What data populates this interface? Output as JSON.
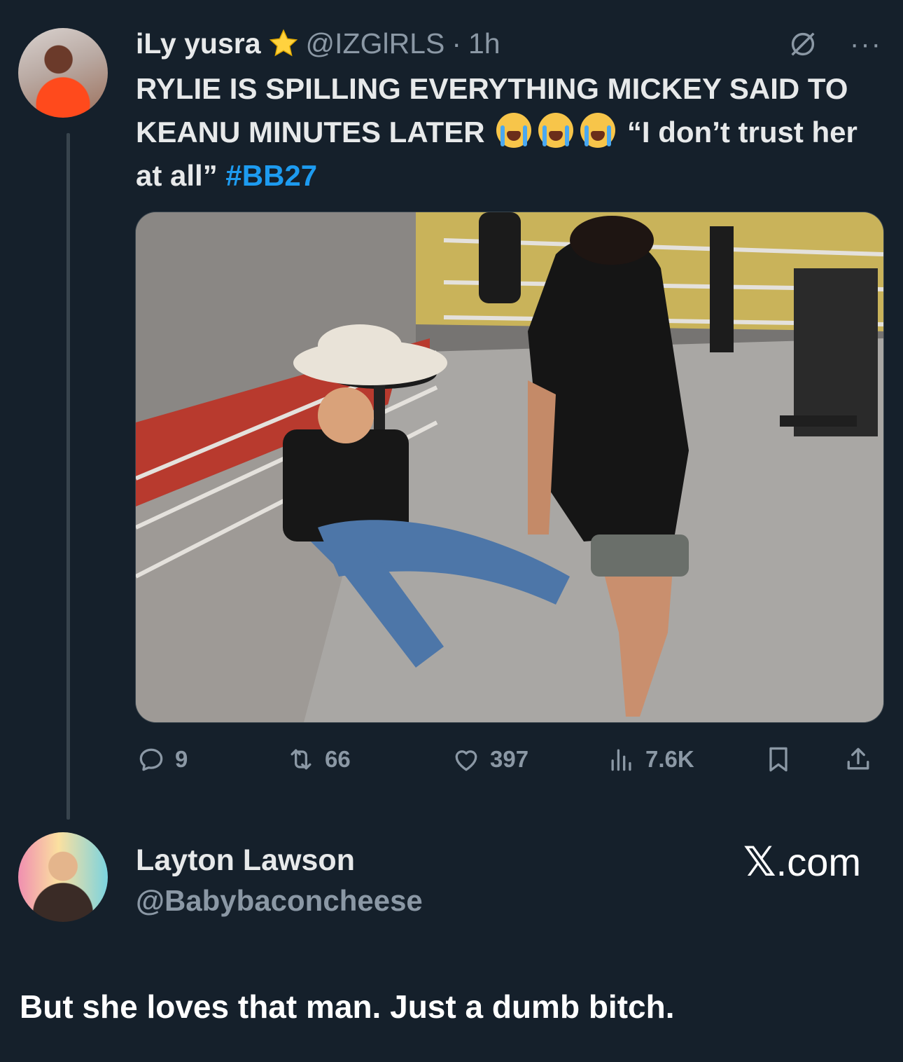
{
  "tweet": {
    "display_name": "iLy yusra",
    "handle": "@IZGlRLS",
    "separator": "·",
    "time": "1h",
    "text_main": "RYLIE IS SPILLING EVERYTHING MICKEY SAID TO KEANU MINUTES LATER",
    "text_quote": "“I don’t trust her at all”",
    "hashtag": "#BB27",
    "more_label": "···",
    "stats": {
      "replies": "9",
      "reposts": "66",
      "likes": "397",
      "views": "7.6K"
    }
  },
  "reply": {
    "display_name": "Layton Lawson",
    "handle": "@Babybaconcheese",
    "text": "But she loves that man. Just a dumb bitch."
  },
  "watermark": {
    "logo": "𝕏",
    "suffix": ".com"
  },
  "icons": {
    "verified": "star-icon",
    "grok": "slash-circle-icon",
    "emoji": "loudly-crying-face-icon"
  },
  "colors": {
    "background": "#15202b",
    "accent": "#1d9bf0",
    "muted": "#8b98a5",
    "star": "#ffd23f"
  }
}
